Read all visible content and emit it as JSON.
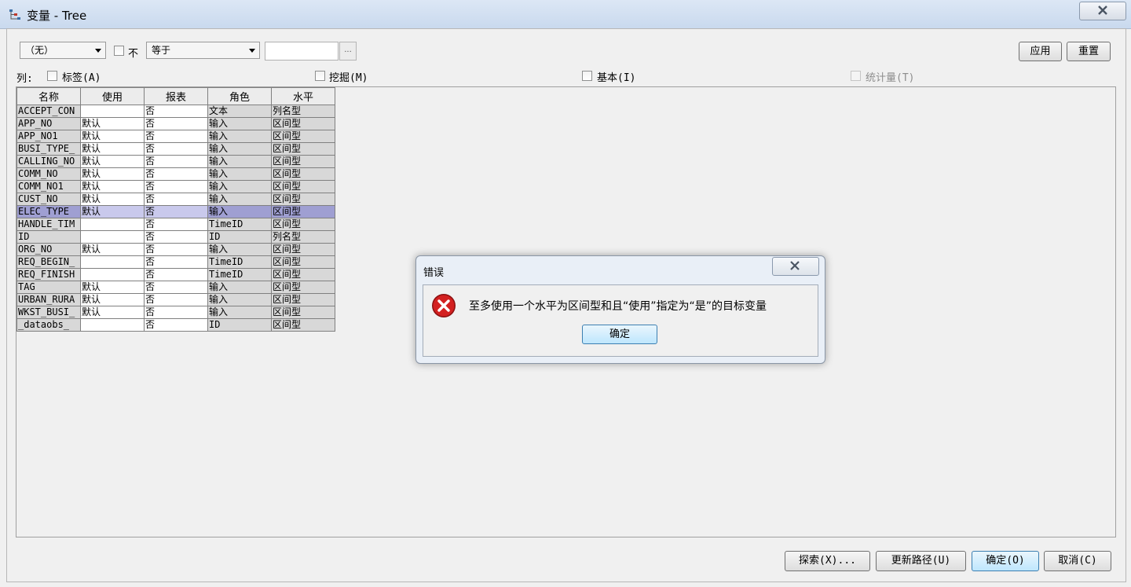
{
  "window": {
    "title": "变量 - Tree",
    "icon": "tree-node-icon"
  },
  "filter": {
    "field_select": "（无）",
    "not_label": "不",
    "operator_select": "等于",
    "value_input": "",
    "ellipsis": "...",
    "apply_label": "应用",
    "reset_label": "重置"
  },
  "columns_bar": {
    "label": "列:",
    "label_opt": "标签(A)",
    "mining_opt": "挖掘(M)",
    "basic_opt": "基本(I)",
    "stats_opt": "统计量(T)"
  },
  "table": {
    "headers": [
      "名称",
      "使用",
      "报表",
      "角色",
      "水平"
    ],
    "rows": [
      [
        "ACCEPT_CON",
        "",
        "否",
        "文本",
        "列名型"
      ],
      [
        "APP_NO",
        "默认",
        "否",
        "输入",
        "区间型"
      ],
      [
        "APP_NO1",
        "默认",
        "否",
        "输入",
        "区间型"
      ],
      [
        "BUSI_TYPE_",
        "默认",
        "否",
        "输入",
        "区间型"
      ],
      [
        "CALLING_NO",
        "默认",
        "否",
        "输入",
        "区间型"
      ],
      [
        "COMM_NO",
        "默认",
        "否",
        "输入",
        "区间型"
      ],
      [
        "COMM_NO1",
        "默认",
        "否",
        "输入",
        "区间型"
      ],
      [
        "CUST_NO",
        "默认",
        "否",
        "输入",
        "区间型"
      ],
      [
        "ELEC_TYPE",
        "默认",
        "否",
        "输入",
        "区间型"
      ],
      [
        "HANDLE_TIM",
        "",
        "否",
        "TimeID",
        "区间型"
      ],
      [
        "ID",
        "",
        "否",
        "ID",
        "列名型"
      ],
      [
        "ORG_NO",
        "默认",
        "否",
        "输入",
        "区间型"
      ],
      [
        "REQ_BEGIN_",
        "",
        "否",
        "TimeID",
        "区间型"
      ],
      [
        "REQ_FINISH",
        "",
        "否",
        "TimeID",
        "区间型"
      ],
      [
        "TAG",
        "默认",
        "否",
        "输入",
        "区间型"
      ],
      [
        "URBAN_RURA",
        "默认",
        "否",
        "输入",
        "区间型"
      ],
      [
        "WKST_BUSI_",
        "默认",
        "否",
        "输入",
        "区间型"
      ],
      [
        "_dataobs_",
        "",
        "否",
        "ID",
        "区间型"
      ]
    ],
    "selected_row": 8
  },
  "bottom_buttons": {
    "explore": "探索(X)...",
    "update_path": "更新路径(U)",
    "ok": "确定(O)",
    "cancel": "取消(C)"
  },
  "error_dialog": {
    "title": "错误",
    "message": "至多使用一个水平为区间型和且“使用”指定为“是”的目标变量",
    "ok_label": "确定",
    "icon": "error-x-icon"
  },
  "colors": {
    "selected_gray": "#9f9fd2",
    "selected_white": "#c9c9ec",
    "error_red": "#d32020"
  }
}
